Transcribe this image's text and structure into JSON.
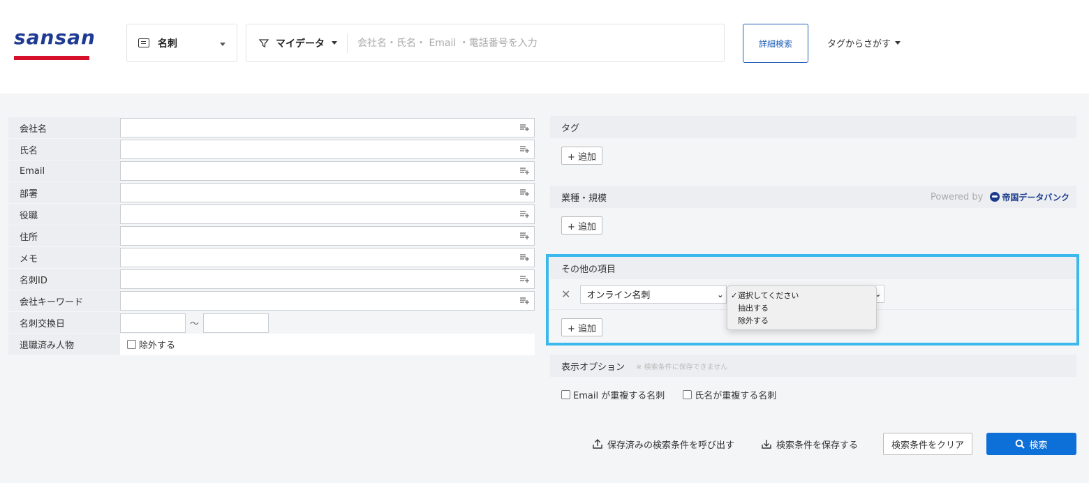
{
  "header": {
    "logo_text": "sansan",
    "type_select": {
      "label": "名刺"
    },
    "scope_select": {
      "label": "マイデータ"
    },
    "search": {
      "placeholder": "会社名・氏名・ Email ・電話番号を入力",
      "value": ""
    },
    "advanced_search_label": "詳細検索",
    "tag_search_label": "タグからさがす"
  },
  "form": {
    "company_label": "会社名",
    "name_label": "氏名",
    "email_label": "Email",
    "department_label": "部署",
    "title_label": "役職",
    "address_label": "住所",
    "memo_label": "メモ",
    "card_id_label": "名刺ID",
    "keyword_label": "会社キーワード",
    "exchange_date_label": "名刺交換日",
    "date_separator": "〜",
    "retired_label": "退職済み人物",
    "retired_checkbox_label": "除外する"
  },
  "panel": {
    "tag_head": "タグ",
    "add_label": "+ 追加",
    "industry_head": "業種・規模",
    "powered_by": "Powered by",
    "tdb_brand": "帝国データバンク",
    "other_head": "その他の項目",
    "other_field_value": "オンライン名刺",
    "dropdown_options": [
      "選択してください",
      "抽出する",
      "除外する"
    ],
    "dropdown_selected_index": 0,
    "options_head": "表示オプション",
    "options_note": "※ 検索条件に保存できません",
    "dup_email_label": "Email が重複する名刺",
    "dup_name_label": "氏名が重複する名刺"
  },
  "actions": {
    "load_saved_label": "保存済みの検索条件を呼び出す",
    "save_label": "検索条件を保存する",
    "clear_label": "検索条件をクリア",
    "search_label": "検索"
  },
  "colors": {
    "brand_blue": "#1f3a93",
    "brand_red": "#d6102a",
    "primary_button": "#0d6fd8",
    "highlight": "#3bb9ec"
  }
}
